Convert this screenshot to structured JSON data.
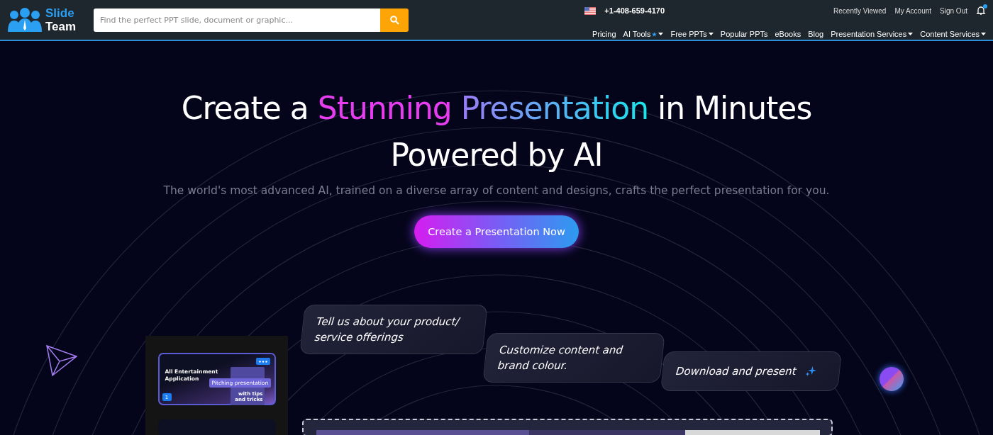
{
  "header": {
    "logo": {
      "line1": "Slide",
      "line2": "Team"
    },
    "search": {
      "placeholder": "Find the perfect PPT slide, document or graphic..."
    },
    "phone": "+1-408-659-4170",
    "account_links": [
      "Recently Viewed",
      "My Account",
      "Sign Out"
    ],
    "notification_dot": true,
    "nav": [
      {
        "label": "Pricing",
        "has_menu": false,
        "star": false
      },
      {
        "label": "AI Tools",
        "has_menu": true,
        "star": true
      },
      {
        "label": "Free PPTs",
        "has_menu": true,
        "star": false
      },
      {
        "label": "Popular PPTs",
        "has_menu": false,
        "star": false
      },
      {
        "label": "eBooks",
        "has_menu": false,
        "star": false
      },
      {
        "label": "Blog",
        "has_menu": false,
        "star": false
      },
      {
        "label": "Presentation Services",
        "has_menu": true,
        "star": false
      },
      {
        "label": "Content Services",
        "has_menu": true,
        "star": false
      }
    ]
  },
  "hero": {
    "title_line1": [
      {
        "text": "Create a ",
        "color": "#ffffff"
      },
      {
        "text": "Stunning ",
        "color": "#e83cf0"
      },
      {
        "text": "Presentation",
        "kind": "gradient"
      },
      {
        "text": " in Minutes",
        "color": "#ffffff"
      }
    ],
    "title_line2": "Powered by AI",
    "subtitle": "The world's most advanced AI, trained on a diverse array of content and designs, crafts the perfect presentation for you.",
    "cta": "Create a Presentation Now"
  },
  "steps": [
    {
      "text": "Tell us about your product/ service offerings",
      "sparkle": false
    },
    {
      "text": "Customize content and brand colour.",
      "sparkle": false
    },
    {
      "text": "Download and present",
      "sparkle": true
    }
  ],
  "slide_preview": {
    "title": "All Entertainment Application",
    "chip": "Pitching presentation",
    "caption": "with tips and tricks",
    "number": "1"
  }
}
